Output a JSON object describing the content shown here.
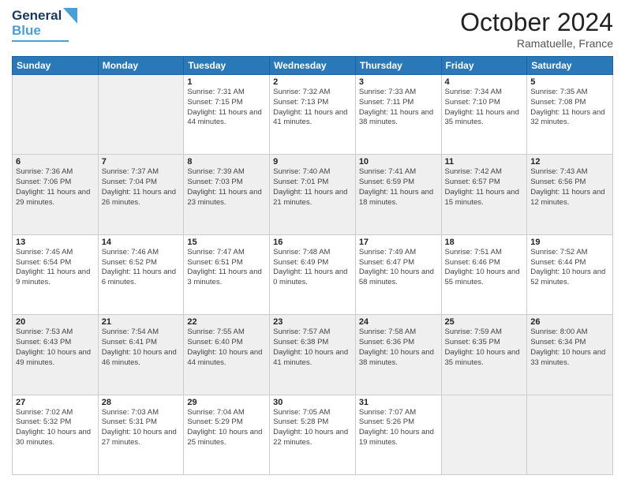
{
  "header": {
    "logo_general": "General",
    "logo_blue": "Blue",
    "month": "October 2024",
    "location": "Ramatuelle, France"
  },
  "weekdays": [
    "Sunday",
    "Monday",
    "Tuesday",
    "Wednesday",
    "Thursday",
    "Friday",
    "Saturday"
  ],
  "weeks": [
    [
      {
        "day": "",
        "sunrise": "",
        "sunset": "",
        "daylight": ""
      },
      {
        "day": "",
        "sunrise": "",
        "sunset": "",
        "daylight": ""
      },
      {
        "day": "1",
        "sunrise": "Sunrise: 7:31 AM",
        "sunset": "Sunset: 7:15 PM",
        "daylight": "Daylight: 11 hours and 44 minutes."
      },
      {
        "day": "2",
        "sunrise": "Sunrise: 7:32 AM",
        "sunset": "Sunset: 7:13 PM",
        "daylight": "Daylight: 11 hours and 41 minutes."
      },
      {
        "day": "3",
        "sunrise": "Sunrise: 7:33 AM",
        "sunset": "Sunset: 7:11 PM",
        "daylight": "Daylight: 11 hours and 38 minutes."
      },
      {
        "day": "4",
        "sunrise": "Sunrise: 7:34 AM",
        "sunset": "Sunset: 7:10 PM",
        "daylight": "Daylight: 11 hours and 35 minutes."
      },
      {
        "day": "5",
        "sunrise": "Sunrise: 7:35 AM",
        "sunset": "Sunset: 7:08 PM",
        "daylight": "Daylight: 11 hours and 32 minutes."
      }
    ],
    [
      {
        "day": "6",
        "sunrise": "Sunrise: 7:36 AM",
        "sunset": "Sunset: 7:06 PM",
        "daylight": "Daylight: 11 hours and 29 minutes."
      },
      {
        "day": "7",
        "sunrise": "Sunrise: 7:37 AM",
        "sunset": "Sunset: 7:04 PM",
        "daylight": "Daylight: 11 hours and 26 minutes."
      },
      {
        "day": "8",
        "sunrise": "Sunrise: 7:39 AM",
        "sunset": "Sunset: 7:03 PM",
        "daylight": "Daylight: 11 hours and 23 minutes."
      },
      {
        "day": "9",
        "sunrise": "Sunrise: 7:40 AM",
        "sunset": "Sunset: 7:01 PM",
        "daylight": "Daylight: 11 hours and 21 minutes."
      },
      {
        "day": "10",
        "sunrise": "Sunrise: 7:41 AM",
        "sunset": "Sunset: 6:59 PM",
        "daylight": "Daylight: 11 hours and 18 minutes."
      },
      {
        "day": "11",
        "sunrise": "Sunrise: 7:42 AM",
        "sunset": "Sunset: 6:57 PM",
        "daylight": "Daylight: 11 hours and 15 minutes."
      },
      {
        "day": "12",
        "sunrise": "Sunrise: 7:43 AM",
        "sunset": "Sunset: 6:56 PM",
        "daylight": "Daylight: 11 hours and 12 minutes."
      }
    ],
    [
      {
        "day": "13",
        "sunrise": "Sunrise: 7:45 AM",
        "sunset": "Sunset: 6:54 PM",
        "daylight": "Daylight: 11 hours and 9 minutes."
      },
      {
        "day": "14",
        "sunrise": "Sunrise: 7:46 AM",
        "sunset": "Sunset: 6:52 PM",
        "daylight": "Daylight: 11 hours and 6 minutes."
      },
      {
        "day": "15",
        "sunrise": "Sunrise: 7:47 AM",
        "sunset": "Sunset: 6:51 PM",
        "daylight": "Daylight: 11 hours and 3 minutes."
      },
      {
        "day": "16",
        "sunrise": "Sunrise: 7:48 AM",
        "sunset": "Sunset: 6:49 PM",
        "daylight": "Daylight: 11 hours and 0 minutes."
      },
      {
        "day": "17",
        "sunrise": "Sunrise: 7:49 AM",
        "sunset": "Sunset: 6:47 PM",
        "daylight": "Daylight: 10 hours and 58 minutes."
      },
      {
        "day": "18",
        "sunrise": "Sunrise: 7:51 AM",
        "sunset": "Sunset: 6:46 PM",
        "daylight": "Daylight: 10 hours and 55 minutes."
      },
      {
        "day": "19",
        "sunrise": "Sunrise: 7:52 AM",
        "sunset": "Sunset: 6:44 PM",
        "daylight": "Daylight: 10 hours and 52 minutes."
      }
    ],
    [
      {
        "day": "20",
        "sunrise": "Sunrise: 7:53 AM",
        "sunset": "Sunset: 6:43 PM",
        "daylight": "Daylight: 10 hours and 49 minutes."
      },
      {
        "day": "21",
        "sunrise": "Sunrise: 7:54 AM",
        "sunset": "Sunset: 6:41 PM",
        "daylight": "Daylight: 10 hours and 46 minutes."
      },
      {
        "day": "22",
        "sunrise": "Sunrise: 7:55 AM",
        "sunset": "Sunset: 6:40 PM",
        "daylight": "Daylight: 10 hours and 44 minutes."
      },
      {
        "day": "23",
        "sunrise": "Sunrise: 7:57 AM",
        "sunset": "Sunset: 6:38 PM",
        "daylight": "Daylight: 10 hours and 41 minutes."
      },
      {
        "day": "24",
        "sunrise": "Sunrise: 7:58 AM",
        "sunset": "Sunset: 6:36 PM",
        "daylight": "Daylight: 10 hours and 38 minutes."
      },
      {
        "day": "25",
        "sunrise": "Sunrise: 7:59 AM",
        "sunset": "Sunset: 6:35 PM",
        "daylight": "Daylight: 10 hours and 35 minutes."
      },
      {
        "day": "26",
        "sunrise": "Sunrise: 8:00 AM",
        "sunset": "Sunset: 6:34 PM",
        "daylight": "Daylight: 10 hours and 33 minutes."
      }
    ],
    [
      {
        "day": "27",
        "sunrise": "Sunrise: 7:02 AM",
        "sunset": "Sunset: 5:32 PM",
        "daylight": "Daylight: 10 hours and 30 minutes."
      },
      {
        "day": "28",
        "sunrise": "Sunrise: 7:03 AM",
        "sunset": "Sunset: 5:31 PM",
        "daylight": "Daylight: 10 hours and 27 minutes."
      },
      {
        "day": "29",
        "sunrise": "Sunrise: 7:04 AM",
        "sunset": "Sunset: 5:29 PM",
        "daylight": "Daylight: 10 hours and 25 minutes."
      },
      {
        "day": "30",
        "sunrise": "Sunrise: 7:05 AM",
        "sunset": "Sunset: 5:28 PM",
        "daylight": "Daylight: 10 hours and 22 minutes."
      },
      {
        "day": "31",
        "sunrise": "Sunrise: 7:07 AM",
        "sunset": "Sunset: 5:26 PM",
        "daylight": "Daylight: 10 hours and 19 minutes."
      },
      {
        "day": "",
        "sunrise": "",
        "sunset": "",
        "daylight": ""
      },
      {
        "day": "",
        "sunrise": "",
        "sunset": "",
        "daylight": ""
      }
    ]
  ]
}
